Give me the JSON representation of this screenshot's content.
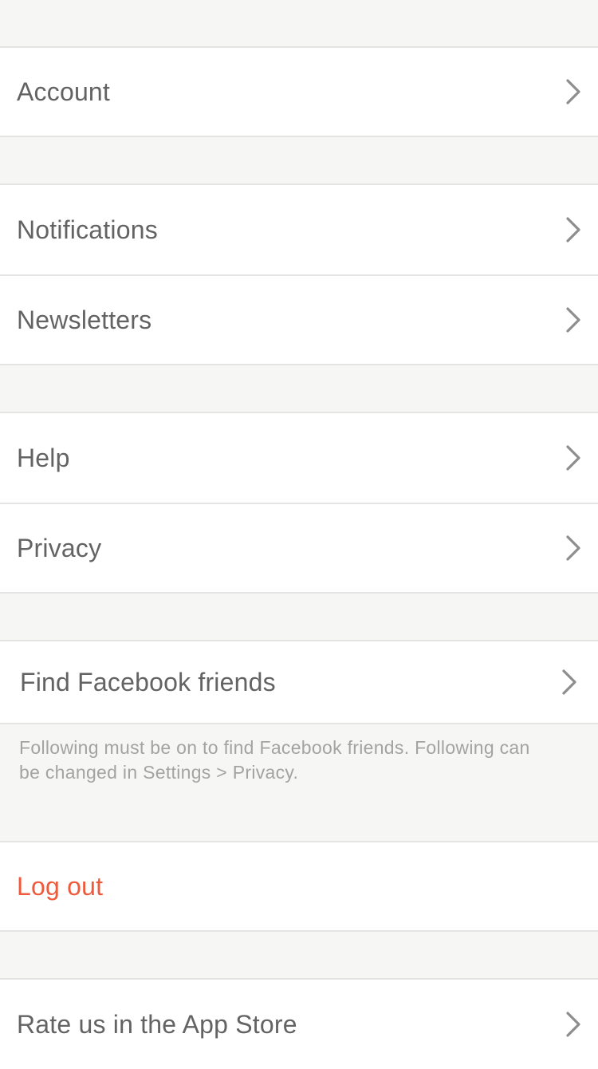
{
  "settings": {
    "account_label": "Account",
    "notifications_label": "Notifications",
    "newsletters_label": "Newsletters",
    "help_label": "Help",
    "privacy_label": "Privacy",
    "find_facebook_friends_label": "Find Facebook friends",
    "facebook_footnote": "Following must be on to find Facebook friends. Following can be changed in Settings > Privacy.",
    "logout_label": "Log out",
    "rate_label": "Rate us in the App Store"
  },
  "colors": {
    "background": "#f6f6f4",
    "cell": "#ffffff",
    "text": "#636363",
    "danger": "#ef5a3c",
    "chevron": "#8e8e8e",
    "footnote": "#a3a3a1"
  },
  "icons": {
    "disclosure": "chevron-right-icon"
  }
}
